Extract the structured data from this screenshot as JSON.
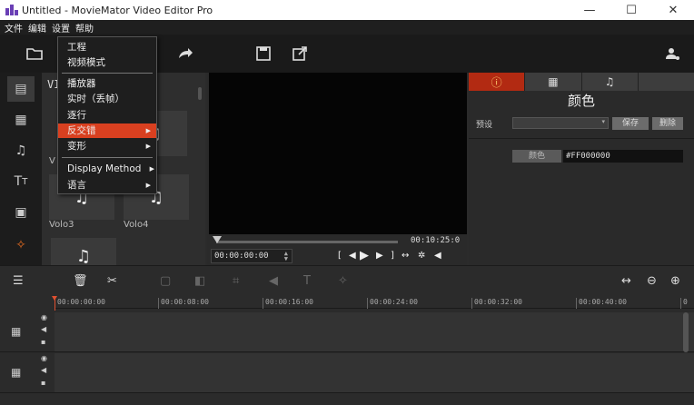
{
  "window": {
    "title": "Untitled - MovieMator Video Editor Pro",
    "minimize": "—",
    "maximize": "☐",
    "close": "✕"
  },
  "menubar": {
    "items": [
      "文件",
      "编辑",
      "设置",
      "帮助"
    ]
  },
  "dropdown": {
    "items": [
      {
        "label": "工程",
        "submenu": false,
        "highlighted": false
      },
      {
        "label": "视频模式",
        "submenu": false,
        "highlighted": false
      },
      {
        "label": "播放器",
        "submenu": false,
        "highlighted": false
      },
      {
        "label": "实时（丢帧）",
        "submenu": false,
        "highlighted": false
      },
      {
        "label": "逐行",
        "submenu": false,
        "highlighted": false
      },
      {
        "label": "反交错",
        "submenu": true,
        "highlighted": true
      },
      {
        "label": "变形",
        "submenu": true,
        "highlighted": false
      },
      {
        "label": "Display Method",
        "submenu": true,
        "highlighted": false
      },
      {
        "label": "语言",
        "submenu": true,
        "highlighted": false
      }
    ]
  },
  "bin": {
    "header_text": "VI",
    "thumbs": [
      {
        "label": "V",
        "icon": "music-note-icon",
        "glyph": "♫"
      },
      {
        "label": "Volo3",
        "icon": "music-note-icon",
        "glyph": "♫"
      },
      {
        "label": "Volo4",
        "icon": "music-note-icon",
        "glyph": "♫"
      },
      {
        "label": "",
        "icon": "music-note-icon",
        "glyph": "♫"
      }
    ]
  },
  "viewer": {
    "current_timecode": "00:00:00:00",
    "total_timecode": "00:10:25:0"
  },
  "properties": {
    "title": "颜色",
    "preset_label": "预设",
    "save_label": "保存",
    "delete_label": "删除",
    "color_label": "颜色",
    "color_value": "#FF000000",
    "active_tab_color": "#b22a12"
  },
  "timeline": {
    "ruler": [
      "00:00:00:00",
      "00:00:08:00",
      "00:00:16:00",
      "00:00:24:00",
      "00:00:32:00",
      "00:00:40:00"
    ]
  },
  "colors": {
    "highlight": "#d94020",
    "accent": "#b22a12"
  }
}
